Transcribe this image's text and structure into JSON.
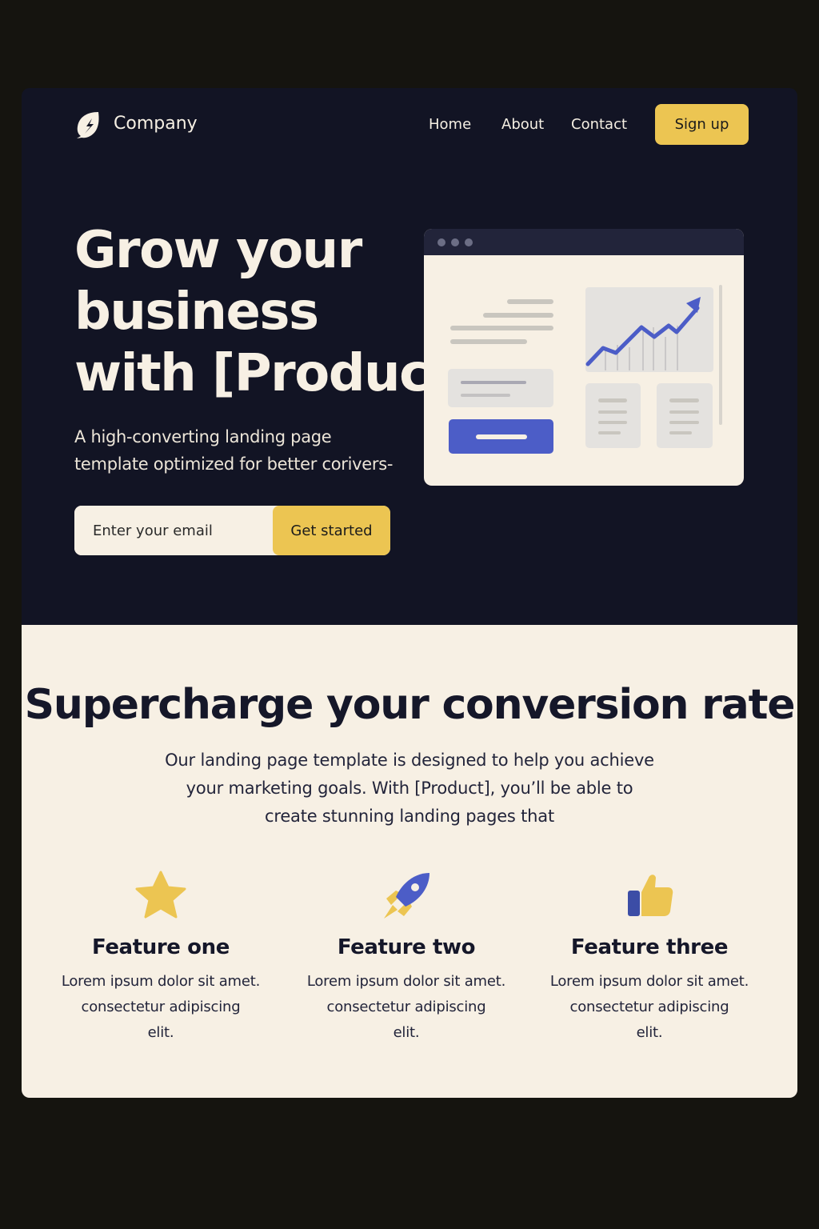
{
  "nav": {
    "brand": "Company",
    "links": [
      "Home",
      "About",
      "Contact"
    ],
    "signup_label": "Sign up"
  },
  "hero": {
    "title_lines": [
      "Grow your",
      "business",
      "with [Product]"
    ],
    "subtitle_lines": [
      "A high-converting landing page",
      "template optimized for better corivers-"
    ],
    "email_placeholder": "Enter your email",
    "cta_label": "Get started"
  },
  "section": {
    "title": "Supercharge your conversion rate",
    "description_lines": [
      "Our landing page template is designed to help you achieve",
      "your marketing goals. With [Product], you’ll be able to",
      "create stunning landing pages that"
    ]
  },
  "features": [
    {
      "icon": "star-icon",
      "title": "Feature one",
      "text_lines": [
        "Lorem ipsum dolor sit amet.",
        "consectetur adipiscing",
        "elit."
      ]
    },
    {
      "icon": "rocket-icon",
      "title": "Feature two",
      "text_lines": [
        "Lorem ipsum dolor sit amet.",
        "consectetur adipiscing",
        "elit."
      ]
    },
    {
      "icon": "thumbs-up-icon",
      "title": "Feature three",
      "text_lines": [
        "Lorem ipsum dolor sit amet.",
        "consectetur adipiscing",
        "elit."
      ]
    }
  ],
  "colors": {
    "hero_background": "#121424",
    "section_background": "#f7f0e4",
    "accent_yellow": "#ecc552",
    "accent_blue": "#4c5dc7",
    "page_background": "#15140f"
  }
}
